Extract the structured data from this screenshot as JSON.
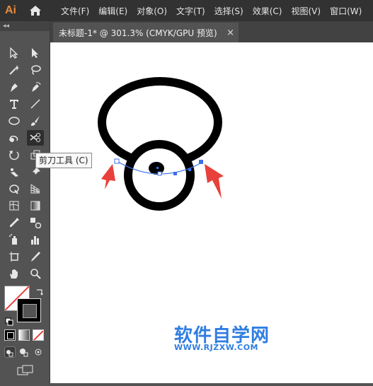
{
  "app": {
    "logo_text": "Ai"
  },
  "menu": {
    "items": [
      "文件(F)",
      "编辑(E)",
      "对象(O)",
      "文字(T)",
      "选择(S)",
      "效果(C)",
      "视图(V)",
      "窗口(W)"
    ]
  },
  "document_tab": {
    "title": "未标题-1* @ 301.3% (CMYK/GPU 预览)",
    "close_symbol": "×"
  },
  "toolbar": {
    "collapse_symbol": "◂◂",
    "active_tool": "scissors-tool",
    "tools": [
      "selection-tool",
      "direct-selection-tool",
      "magic-wand-tool",
      "lasso-tool",
      "pen-tool",
      "curvature-tool",
      "type-tool",
      "line-segment-tool",
      "ellipse-tool",
      "paintbrush-tool",
      "shaper-tool",
      "scissors-tool",
      "rotate-tool",
      "scale-tool",
      "puppet-warp-tool",
      "pin-tool",
      "shape-builder-tool",
      "perspective-grid-tool",
      "mesh-tool",
      "gradient-tool",
      "eyedropper-tool",
      "blend-tool",
      "symbol-sprayer-tool",
      "column-graph-tool",
      "artboard-tool",
      "slice-tool",
      "hand-tool",
      "zoom-tool"
    ]
  },
  "tooltip": {
    "text": "剪刀工具 (C)"
  },
  "watermark": {
    "main": "软件自学网",
    "url": "WWW.RJZXW.COM"
  },
  "colors": {
    "accent": "#2f7de1",
    "arrow": "#e8403a",
    "path_selection": "#3c6fe8",
    "fill": "#ffffff",
    "stroke": "#000000"
  }
}
